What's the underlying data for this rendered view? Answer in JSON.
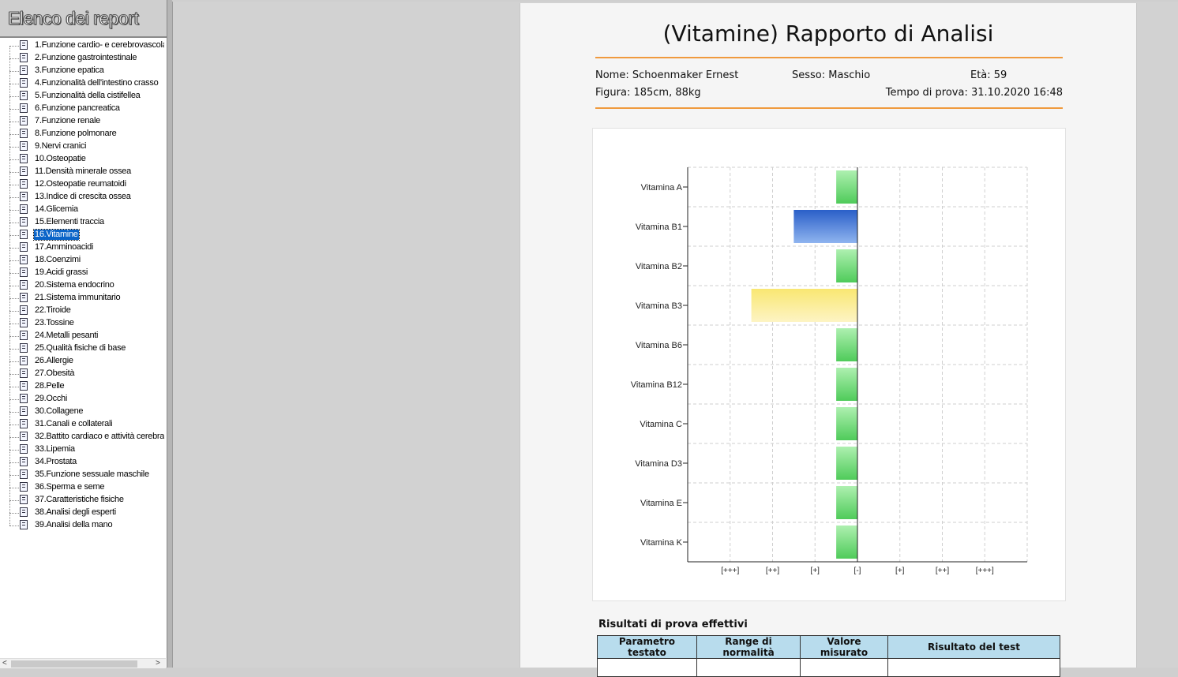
{
  "sidebar": {
    "title": "Elenco dei report",
    "selected_index": 15,
    "items": [
      "1.Funzione cardio- e cerebrovascolare",
      "2.Funzione gastrointestinale",
      "3.Funzione epatica",
      "4.Funzionalità dell'intestino crasso",
      "5.Funzionalità della cistifellea",
      "6.Funzione pancreatica",
      "7.Funzione renale",
      "8.Funzione polmonare",
      "9.Nervi cranici",
      "10.Osteopatie",
      "11.Densità minerale ossea",
      "12.Osteopatie reumatoidi",
      "13.Indice di crescita ossea",
      "14.Glicemia",
      "15.Elementi traccia",
      "16.Vitamine",
      "17.Amminoacidi",
      "18.Coenzimi",
      "19.Acidi grassi",
      "20.Sistema endocrino",
      "21.Sistema immunitario",
      "22.Tiroide",
      "23.Tossine",
      "24.Metalli pesanti",
      "25.Qualità fisiche di base",
      "26.Allergie",
      "27.Obesità",
      "28.Pelle",
      "29.Occhi",
      "30.Collagene",
      "31.Canali e collaterali",
      "32.Battito cardiaco e attività cerebrale",
      "33.Lipemia",
      "34.Prostata",
      "35.Funzione sessuale maschile",
      "36.Sperma e seme",
      "37.Caratteristiche fisiche",
      "38.Analisi degli esperti",
      "39.Analisi della mano"
    ]
  },
  "report": {
    "title": "(Vitamine) Rapporto di Analisi",
    "name": "Nome: Schoenmaker Ernest",
    "sex": "Sesso: Maschio",
    "age": "Età: 59",
    "figure": "Figura: 185cm, 88kg",
    "test_time": "Tempo di prova: 31.10.2020 16:48",
    "results_title": "Risultati di prova effettivi",
    "table_headers": [
      "Parametro testato",
      "Range di normalità",
      "Valore misurato",
      "Risultato del test"
    ]
  },
  "chart_data": {
    "type": "bar",
    "orientation": "horizontal",
    "categories": [
      "Vitamina A",
      "Vitamina B1",
      "Vitamina B2",
      "Vitamina B3",
      "Vitamina B6",
      "Vitamina B12",
      "Vitamina C",
      "Vitamina D3",
      "Vitamina E",
      "Vitamina K"
    ],
    "x_tick_labels": [
      "[+++]",
      "[++]",
      "[+]",
      "[-]",
      "[+]",
      "[++]",
      "[+++]"
    ],
    "xlim": [
      -4,
      4
    ],
    "values": [
      -0.5,
      -1.5,
      -0.5,
      -2.5,
      -0.5,
      -0.5,
      -0.5,
      -0.5,
      -0.5,
      -0.5
    ],
    "bar_colors": [
      "#5fd36a",
      "#2e6fd1",
      "#5fd36a",
      "#f7e46a",
      "#5fd36a",
      "#5fd36a",
      "#5fd36a",
      "#5fd36a",
      "#5fd36a",
      "#5fd36a"
    ],
    "grid": true
  }
}
